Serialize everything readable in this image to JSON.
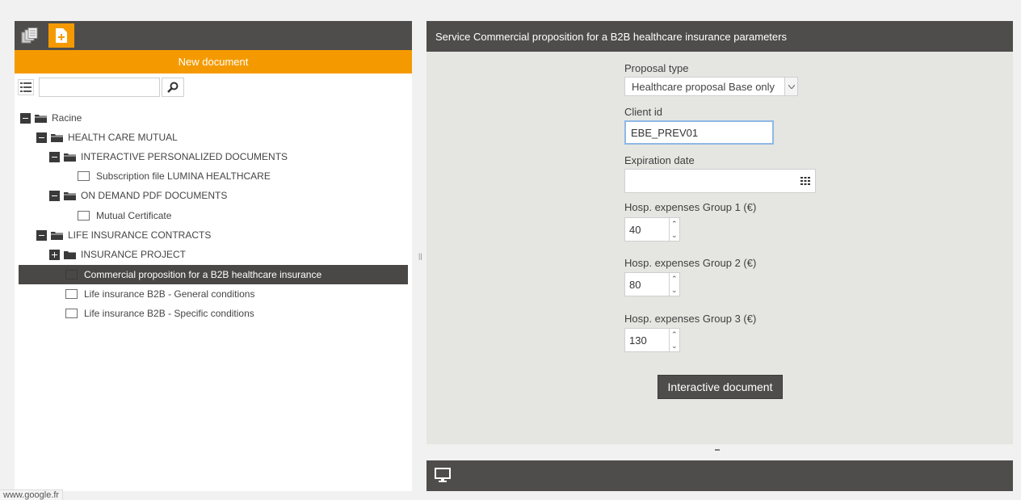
{
  "left_panel": {
    "new_document_label": "New document",
    "search": {
      "value": "",
      "placeholder": ""
    },
    "tree": [
      {
        "label": "Racine",
        "kind": "folder",
        "expander": "minus"
      },
      {
        "label": "HEALTH CARE MUTUAL",
        "kind": "folder",
        "expander": "minus"
      },
      {
        "label": "INTERACTIVE PERSONALIZED DOCUMENTS",
        "kind": "folder",
        "expander": "minus"
      },
      {
        "label": "Subscription file LUMINA HEALTHCARE",
        "kind": "document"
      },
      {
        "label": "ON DEMAND PDF DOCUMENTS",
        "kind": "folder",
        "expander": "minus"
      },
      {
        "label": "Mutual Certificate",
        "kind": "document"
      },
      {
        "label": "LIFE INSURANCE CONTRACTS",
        "kind": "folder",
        "expander": "minus"
      },
      {
        "label": "INSURANCE PROJECT",
        "kind": "folder",
        "expander": "plus"
      },
      {
        "label": "Commercial proposition for a B2B healthcare insurance",
        "kind": "document",
        "selected": true
      },
      {
        "label": "Life insurance B2B - General conditions",
        "kind": "document"
      },
      {
        "label": "Life insurance B2B - Specific conditions",
        "kind": "document"
      }
    ]
  },
  "splitter": {
    "grip": "||"
  },
  "right_panel": {
    "title": "Service Commercial proposition for a B2B healthcare insurance parameters",
    "fields": {
      "proposal_type": {
        "label": "Proposal type",
        "value": "Healthcare proposal Base only"
      },
      "client_id": {
        "label": "Client id",
        "value": "EBE_PREV01"
      },
      "expiration_date": {
        "label": "Expiration date",
        "value": ""
      },
      "hosp_group_1": {
        "label": "Hosp. expenses Group 1 (€)",
        "value": "40"
      },
      "hosp_group_2": {
        "label": "Hosp. expenses Group 2 (€)",
        "value": "80"
      },
      "hosp_group_3": {
        "label": "Hosp. expenses Group 3 (€)",
        "value": "130"
      }
    },
    "submit_label": "Interactive document"
  },
  "status_bar": {
    "url": "www.google.fr"
  },
  "colors": {
    "accent": "#f49a00",
    "header": "#4f4d4b",
    "panel_bg": "#e5e5e2"
  },
  "icons": [
    "documents-icon",
    "new-document-icon",
    "list-icon",
    "search-icon",
    "calendar-icon",
    "monitor-icon",
    "folder-icon"
  ]
}
